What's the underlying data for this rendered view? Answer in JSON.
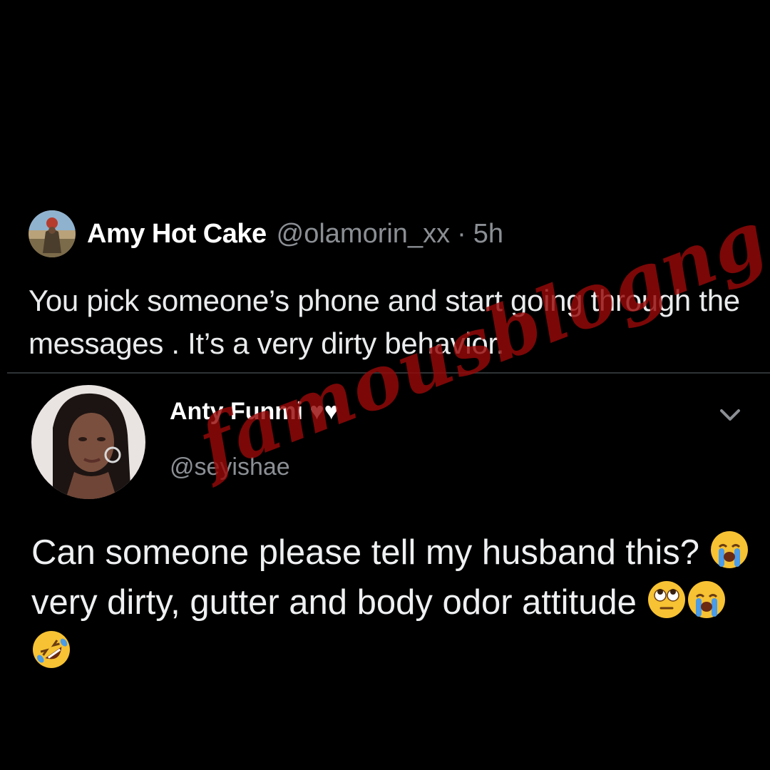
{
  "quoted_tweet": {
    "author_name": "Amy Hot Cake",
    "author_handle": "@olamorin_xx",
    "separator": "·",
    "time": "5h",
    "text": "You pick someone’s phone and start going through the messages . It’s a very dirty behavior."
  },
  "main_tweet": {
    "author_name": "Anty Funmi ♥♥",
    "author_handle": "@seyishae",
    "text_part_1": "Can someone please tell my husband this?",
    "text_part_2": "very dirty, gutter and body odor attitude",
    "emoji_inline": "loudly-crying-face",
    "emoji_trailing": [
      "face-with-rolling-eyes",
      "loudly-crying-face",
      "rolling-on-the-floor-laughing"
    ],
    "menu_icon": "chevron-down-icon"
  },
  "watermark": {
    "text": "famousblogng",
    "color": "#960808"
  },
  "colors": {
    "background": "#000000",
    "primary_text": "#e7e9ea",
    "secondary_text": "#8b8f94",
    "divider": "#2f3336"
  }
}
